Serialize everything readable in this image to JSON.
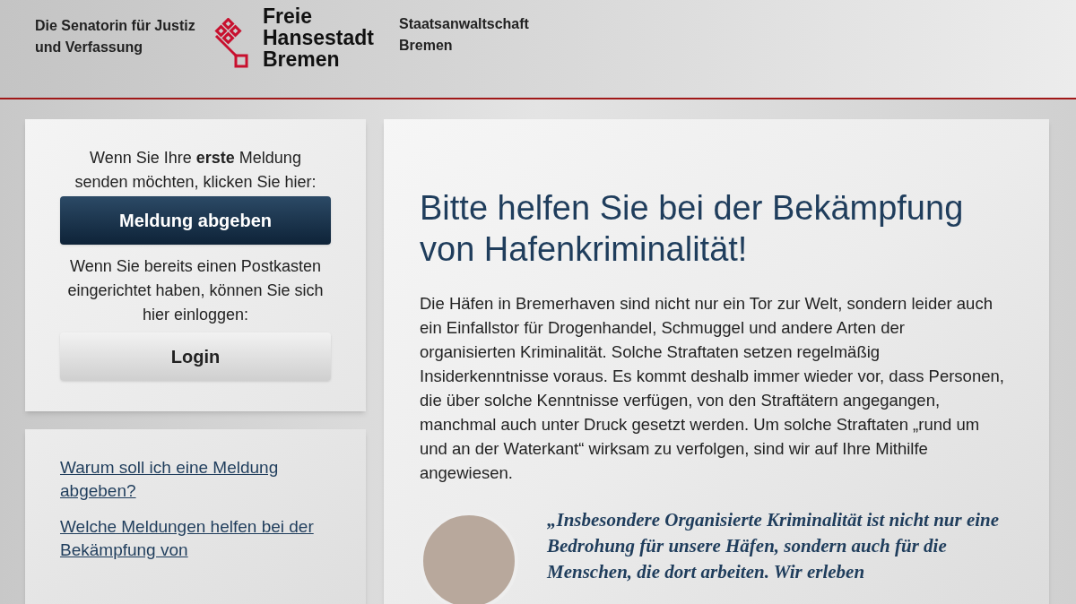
{
  "header": {
    "ministry": [
      "Die Senatorin für Justiz",
      "und Verfassung"
    ],
    "state_name": [
      "Freie",
      "Hansestadt",
      "Bremen"
    ],
    "office": [
      "Staatsanwaltschaft",
      "Bremen"
    ]
  },
  "sidebar": {
    "first_report_text": "Wenn Sie Ihre **erste** Meldung senden möchten, klicken Sie hier:",
    "report_button": "Meldung abgeben",
    "login_text": "Wenn Sie bereits einen Postkasten eingerichtet haben, können Sie sich hier einloggen:",
    "login_button": "Login",
    "links": [
      "Warum soll ich eine Meldung abgeben?",
      "Welche Meldungen helfen bei der Bekämpfung von"
    ]
  },
  "main": {
    "heading": "Bitte helfen Sie bei der Bekämpfung von Hafenkriminalität!",
    "intro": "Die Häfen in Bremerhaven sind nicht nur ein Tor zur Welt, sondern leider auch ein Einfallstor für Drogenhandel, Schmuggel und andere Arten der organisierten Kriminalität. Solche Straftaten setzen regelmäßig Insiderkenntnisse voraus. Es kommt deshalb immer wieder vor, dass Personen, die über solche Kenntnisse verfügen, von den Straftätern angegangen, manchmal auch unter Druck gesetzt werden. Um solche Straftaten „rund um und an der Waterkant“ wirksam zu verfolgen, sind wir auf Ihre Mithilfe angewiesen.",
    "quote": "„Insbesondere Organisierte Kriminalität ist nicht nur eine Bedrohung für unsere Häfen, sondern auch für die Menschen, die dort arbeiten. Wir erleben"
  }
}
